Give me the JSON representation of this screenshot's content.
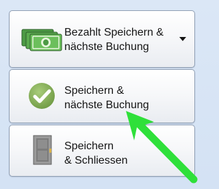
{
  "buttons": [
    {
      "line1": "Bezahlt Speichern &",
      "line2": "nächste Buchung",
      "icon": "money-icon",
      "has_dropdown": true
    },
    {
      "line1": "Speichern &",
      "line2": "nächste Buchung",
      "icon": "check-icon",
      "has_dropdown": false
    },
    {
      "line1": "Speichern",
      "line2": "& Schliessen",
      "icon": "door-icon",
      "has_dropdown": false
    }
  ],
  "colors": {
    "background": "#d4e2f4",
    "annotation_arrow": "#2fe03a",
    "money_green": "#3f8a3a",
    "check_green": "#8db35f",
    "door_gray": "#8a8a8a"
  },
  "annotation": {
    "type": "arrow",
    "points_to": "Speichern & nächste Buchung button"
  }
}
